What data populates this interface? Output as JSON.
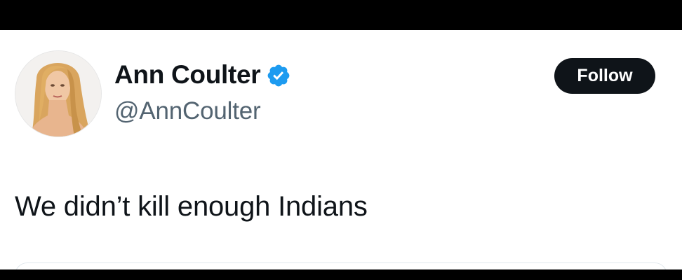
{
  "tweet": {
    "author": {
      "display_name": "Ann Coulter",
      "handle": "@AnnCoulter",
      "verified": true,
      "avatar_icon": "profile-photo-icon",
      "verified_icon": "verified-badge-icon",
      "verified_color": "#1d9bf0"
    },
    "follow_button_label": "Follow",
    "text": "We didn’t kill enough Indians"
  },
  "colors": {
    "text_primary": "#0f1419",
    "text_secondary": "#536471",
    "button_bg": "#0f1419",
    "background": "#ffffff",
    "frame": "#000000"
  }
}
